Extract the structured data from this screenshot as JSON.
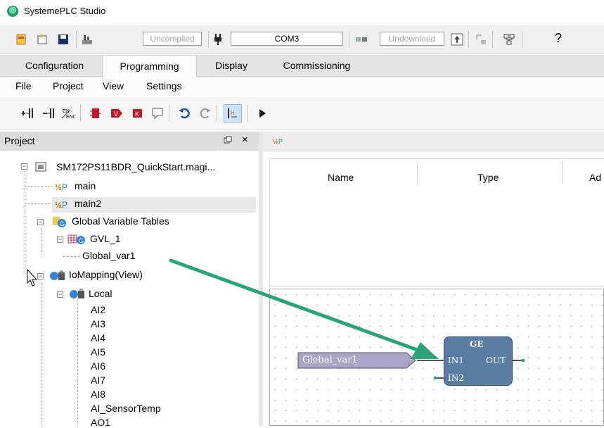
{
  "app": {
    "title": "SystemePLC Studio"
  },
  "toolbar": {
    "compile_status": "Uncompiled",
    "port": "COM3",
    "download_status": "Undownload"
  },
  "tabs": [
    {
      "label": "Configuration"
    },
    {
      "label": "Programming",
      "active": true
    },
    {
      "label": "Display"
    },
    {
      "label": "Commissioning"
    }
  ],
  "menu": [
    "File",
    "Project",
    "View",
    "Settings"
  ],
  "project_panel": {
    "title": "Project",
    "pin_icon": "\u0001",
    "close_icon": "×",
    "tree": {
      "root": "SM172PS11BDR_QuickStart.magi...",
      "programs": [
        "main",
        "main2"
      ],
      "global_tables": "Global Variable Tables",
      "gvl": "GVL_1",
      "gvl_var": "Global_var1",
      "iomapping": "IoMapping(View)",
      "local": "Local",
      "channels": [
        "AI2",
        "AI3",
        "AI4",
        "AI5",
        "AI6",
        "AI7",
        "AI8",
        "AI_SensorTemp",
        "AO1"
      ]
    }
  },
  "editor": {
    "columns": [
      "Name",
      "Type",
      "Ad"
    ],
    "fbd": {
      "input_var": "Global_var1",
      "block": {
        "name": "GE",
        "in1": "IN1",
        "in2": "IN2",
        "out": "OUT"
      }
    }
  },
  "colors": {
    "block_fill": "#5a7da3",
    "input_fill": "#a8a5c6",
    "annotation_arrow": "#2aa37a",
    "selected_row": "#e8e8e8"
  }
}
